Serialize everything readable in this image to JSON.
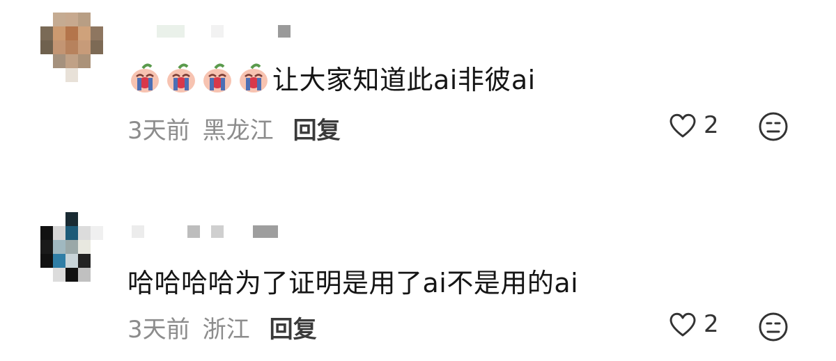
{
  "comments": [
    {
      "text_emoji_count": 4,
      "text": "让大家知道此ai非彼ai",
      "time": "3天前",
      "location": "黑龙江",
      "reply_label": "回复",
      "likes": "2"
    },
    {
      "text": "哈哈哈哈为了证明是用了ai不是用的ai",
      "time": "3天前",
      "location": "浙江",
      "reply_label": "回复",
      "likes": "2"
    }
  ],
  "icons": {
    "like": "heart-outline-icon",
    "dislike": "meh-face-icon",
    "sticker": "crying-peach-sticker"
  },
  "colors": {
    "text": "#151515",
    "meta": "#8c8c8c",
    "reply": "#3a3a3a"
  }
}
